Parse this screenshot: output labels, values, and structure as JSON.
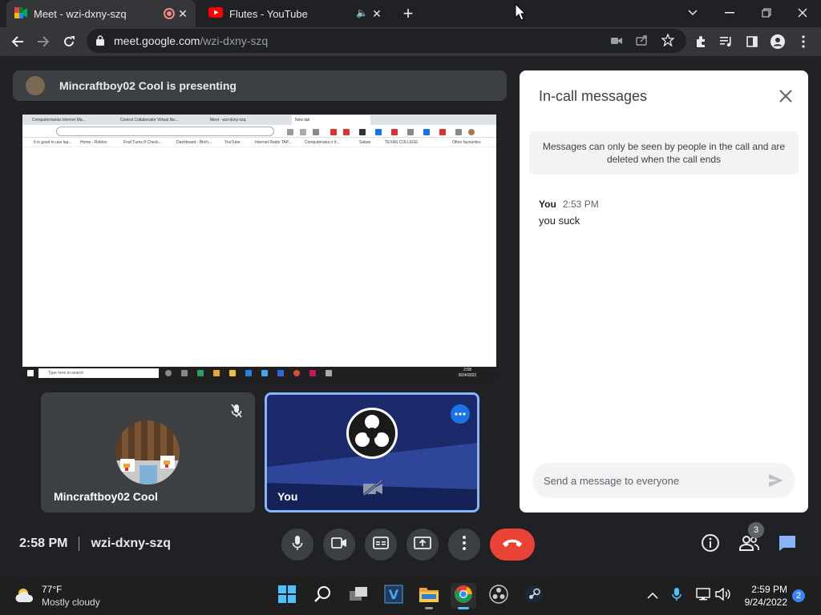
{
  "browser": {
    "tabs": [
      {
        "title": "Meet - wzi-dxny-szq",
        "active": true
      },
      {
        "title": "Flutes - YouTube",
        "active": false
      }
    ],
    "url_host": "meet.google.com",
    "url_path": "/wzi-dxny-szq"
  },
  "meet": {
    "presenting_text": "Mincraftboy02 Cool is presenting",
    "participants": [
      {
        "name": "Mincraftboy02 Cool"
      },
      {
        "name": "You"
      }
    ],
    "time": "2:58 PM",
    "meeting_code": "wzi-dxny-szq",
    "people_count": "3"
  },
  "shared_screen": {
    "tabs": [
      "Computermanta Internet Ma...",
      "Control Collaborator Virtual Ne...",
      "Meet - wzi-dxny-szq",
      "New tab"
    ],
    "bookmarks": [
      "It is good to use lap...",
      "Home - Roblox",
      "Fnaf Turns 8 Check...",
      "Dashboard - Bitch...",
      "YouTube",
      "Internet Radio TAP...",
      "Computerasia ir Ir...",
      "Saban",
      "TEXAS COLLEGE",
      "Other favourites"
    ],
    "search_placeholder": "Type here to search",
    "clock_time": "2:58",
    "clock_date": "9/24/2022"
  },
  "chat": {
    "title": "In-call messages",
    "notice": "Messages can only be seen by people in the call and are deleted when the call ends",
    "messages": [
      {
        "sender": "You",
        "time": "2:53 PM",
        "text": "you suck"
      }
    ],
    "input_placeholder": "Send a message to everyone"
  },
  "taskbar": {
    "weather_temp": "77°F",
    "weather_desc": "Mostly cloudy",
    "time": "2:59 PM",
    "date": "9/24/2022",
    "notification_count": "2"
  },
  "colors": {
    "meet_bg": "#202124",
    "leave_red": "#ea4335",
    "accent_blue": "#8ab4f8",
    "chat_icon_blue": "#4a90e2"
  }
}
